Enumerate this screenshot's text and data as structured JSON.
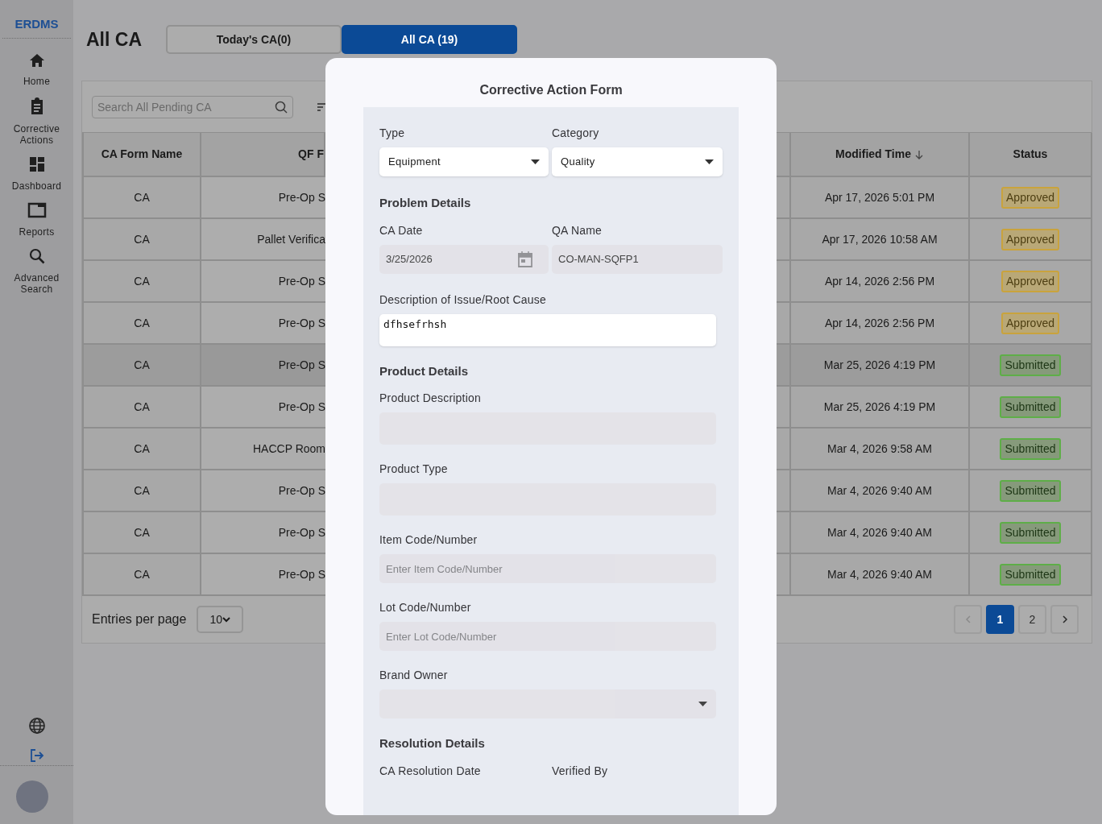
{
  "sidebar": {
    "brand": "ERDMS",
    "items": [
      {
        "label": "Home"
      },
      {
        "label": "Corrective Actions"
      },
      {
        "label": "Dashboard"
      },
      {
        "label": "Reports"
      },
      {
        "label": "Advanced Search"
      }
    ]
  },
  "header": {
    "title": "All CA",
    "tabs": [
      {
        "label": "Today's CA(0)",
        "selected": false
      },
      {
        "label": "All CA (19)",
        "selected": true
      }
    ]
  },
  "search": {
    "placeholder": "Search All Pending CA"
  },
  "table": {
    "columns": [
      {
        "label": "CA Form Name",
        "sorted": false
      },
      {
        "label": "QF F",
        "sorted": false
      },
      {
        "label": "Modified Time",
        "sorted": true
      },
      {
        "label": "Status",
        "sorted": false
      }
    ],
    "rows": [
      {
        "form_name": "CA",
        "column_2": "Pre-Op S",
        "modified_time": "Apr 17, 2026 5:01 PM",
        "status": {
          "label": "Approved",
          "kind": "approved"
        },
        "highlighted": false
      },
      {
        "form_name": "CA",
        "column_2": "Pallet Verifica",
        "modified_time": "Apr 17, 2026 10:58 AM",
        "status": {
          "label": "Approved",
          "kind": "approved"
        },
        "highlighted": false
      },
      {
        "form_name": "CA",
        "column_2": "Pre-Op S",
        "modified_time": "Apr 14, 2026 2:56 PM",
        "status": {
          "label": "Approved",
          "kind": "approved"
        },
        "highlighted": false
      },
      {
        "form_name": "CA",
        "column_2": "Pre-Op S",
        "modified_time": "Apr 14, 2026 2:56 PM",
        "status": {
          "label": "Approved",
          "kind": "approved"
        },
        "highlighted": false
      },
      {
        "form_name": "CA",
        "column_2": "Pre-Op S",
        "modified_time": "Mar 25, 2026 4:19 PM",
        "status": {
          "label": "Submitted",
          "kind": "submitted"
        },
        "highlighted": true
      },
      {
        "form_name": "CA",
        "column_2": "Pre-Op S",
        "modified_time": "Mar 25, 2026 4:19 PM",
        "status": {
          "label": "Submitted",
          "kind": "submitted"
        },
        "highlighted": false
      },
      {
        "form_name": "CA",
        "column_2": "HACCP Room",
        "modified_time": "Mar 4, 2026 9:58 AM",
        "status": {
          "label": "Submitted",
          "kind": "submitted"
        },
        "highlighted": false
      },
      {
        "form_name": "CA",
        "column_2": "Pre-Op S",
        "modified_time": "Mar 4, 2026 9:40 AM",
        "status": {
          "label": "Submitted",
          "kind": "submitted"
        },
        "highlighted": false
      },
      {
        "form_name": "CA",
        "column_2": "Pre-Op S",
        "modified_time": "Mar 4, 2026 9:40 AM",
        "status": {
          "label": "Submitted",
          "kind": "submitted"
        },
        "highlighted": false
      },
      {
        "form_name": "CA",
        "column_2": "Pre-Op S",
        "modified_time": "Mar 4, 2026 9:40 AM",
        "status": {
          "label": "Submitted",
          "kind": "submitted"
        },
        "highlighted": false
      }
    ]
  },
  "footer": {
    "entries_label": "Entries per page",
    "per_page": "10",
    "pages": [
      {
        "label": "1",
        "selected": true
      },
      {
        "label": "2",
        "selected": false
      }
    ]
  },
  "modal": {
    "title": "Corrective Action Form",
    "items": [
      {
        "kind": "pair",
        "fields": [
          {
            "label": "Type",
            "kind": "select",
            "value": "Equipment",
            "disabled": false
          },
          {
            "label": "Category",
            "kind": "select",
            "value": "Quality",
            "disabled": false
          }
        ]
      },
      {
        "kind": "heading",
        "text": "Problem Details"
      },
      {
        "kind": "pair",
        "fields": [
          {
            "label": "CA Date",
            "kind": "date",
            "value": "3/25/2026",
            "disabled": true
          },
          {
            "label": "QA Name",
            "kind": "text",
            "value": "CO-MAN-SQFP1",
            "disabled": true
          }
        ]
      },
      {
        "kind": "field",
        "field": {
          "label": "Description of Issue/Root Cause",
          "kind": "textarea",
          "value": "dfhsefrhsh",
          "disabled": false
        }
      },
      {
        "kind": "heading",
        "text": "Product Details"
      },
      {
        "kind": "field",
        "field": {
          "label": "Product Description",
          "kind": "textarea",
          "disabled": true
        }
      },
      {
        "kind": "field",
        "field": {
          "label": "Product Type",
          "kind": "textarea",
          "disabled": true
        }
      },
      {
        "kind": "field",
        "field": {
          "label": "Item Code/Number",
          "kind": "text",
          "placeholder": "Enter Item Code/Number",
          "disabled": true
        }
      },
      {
        "kind": "field",
        "field": {
          "label": "Lot Code/Number",
          "kind": "text",
          "placeholder": "Enter Lot Code/Number",
          "disabled": true
        }
      },
      {
        "kind": "field",
        "field": {
          "label": "Brand Owner",
          "kind": "select",
          "disabled": true
        }
      },
      {
        "kind": "heading",
        "text": "Resolution Details"
      },
      {
        "kind": "pair",
        "fields": [
          {
            "label": "CA Resolution Date",
            "kind": "label"
          },
          {
            "label": "Verified By",
            "kind": "label"
          }
        ]
      }
    ]
  }
}
